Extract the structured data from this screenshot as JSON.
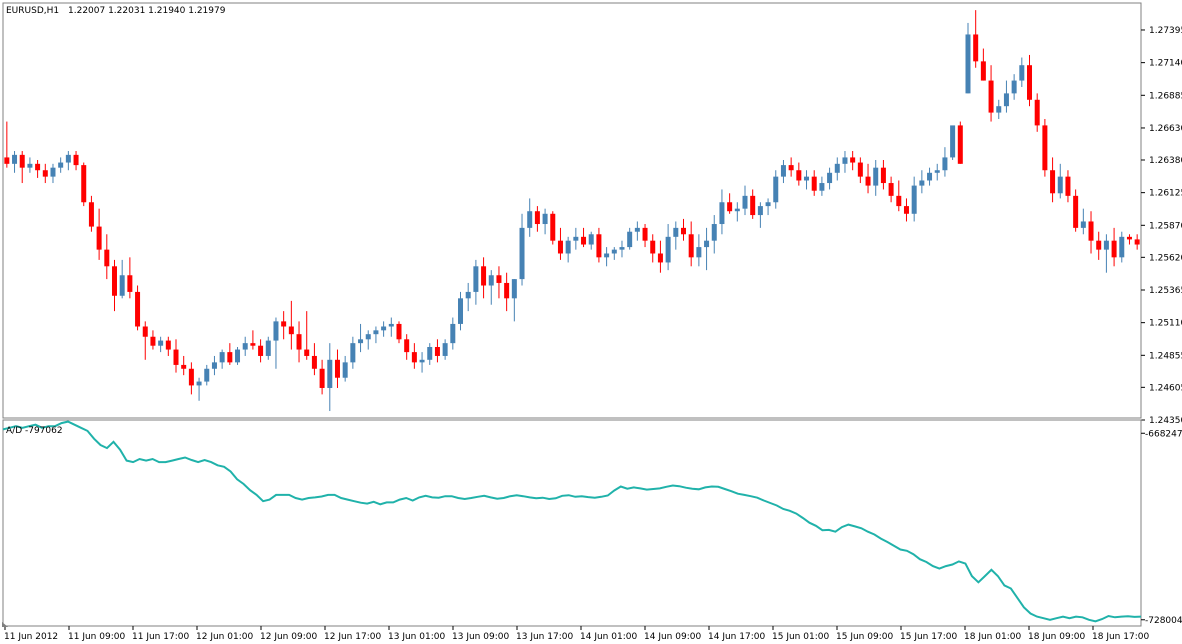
{
  "symbol_header": "EURUSD,H1",
  "ohlc_header": "1.22007 1.22031 1.21940 1.21979",
  "indicator_header": "A/D -797062",
  "colors": {
    "bull": "#4682b4",
    "bear": "#ff0000",
    "ad_line": "#20b2aa",
    "frame": "#808080",
    "background": "#ffffff",
    "text": "#000000"
  },
  "chart_data": [
    {
      "type": "candlestick",
      "title": "EURUSD,H1",
      "price_axis_ticks": [
        "1.27395",
        "1.27140",
        "1.26885",
        "1.26630",
        "1.26380",
        "1.26125",
        "1.25870",
        "1.25620",
        "1.25365",
        "1.25110",
        "1.24855",
        "1.24605",
        "1.24350"
      ],
      "ylim": [
        1.2435,
        1.2759
      ],
      "time_axis_labels": [
        "11 Jun 2012",
        "11 Jun 09:00",
        "11 Jun 17:00",
        "12 Jun 01:00",
        "12 Jun 09:00",
        "12 Jun 17:00",
        "13 Jun 01:00",
        "13 Jun 09:00",
        "13 Jun 17:00",
        "14 Jun 01:00",
        "14 Jun 09:00",
        "14 Jun 17:00",
        "15 Jun 01:00",
        "15 Jun 09:00",
        "15 Jun 17:00",
        "18 Jun 01:00",
        "18 Jun 09:00",
        "18 Jun 17:00"
      ],
      "candles": [
        [
          1.264,
          1.2668,
          1.2632,
          1.2635
        ],
        [
          1.2635,
          1.2645,
          1.2628,
          1.2642
        ],
        [
          1.2642,
          1.2645,
          1.262,
          1.2632
        ],
        [
          1.2632,
          1.264,
          1.2628,
          1.2635
        ],
        [
          1.2635,
          1.2638,
          1.2624,
          1.263
        ],
        [
          1.263,
          1.2635,
          1.262,
          1.2625
        ],
        [
          1.2625,
          1.2635,
          1.262,
          1.2632
        ],
        [
          1.2632,
          1.264,
          1.2628,
          1.2636
        ],
        [
          1.2636,
          1.2645,
          1.263,
          1.2642
        ],
        [
          1.2642,
          1.2645,
          1.263,
          1.2634
        ],
        [
          1.2634,
          1.2636,
          1.2602,
          1.2605
        ],
        [
          1.2605,
          1.261,
          1.2582,
          1.2586
        ],
        [
          1.2586,
          1.26,
          1.256,
          1.2568
        ],
        [
          1.2568,
          1.258,
          1.2545,
          1.2555
        ],
        [
          1.2555,
          1.256,
          1.252,
          1.2532
        ],
        [
          1.2532,
          1.256,
          1.253,
          1.2548
        ],
        [
          1.2548,
          1.2562,
          1.253,
          1.2535
        ],
        [
          1.2535,
          1.254,
          1.2505,
          1.2508
        ],
        [
          1.2508,
          1.2512,
          1.2482,
          1.25
        ],
        [
          1.25,
          1.2505,
          1.249,
          1.2493
        ],
        [
          1.2493,
          1.25,
          1.2488,
          1.2497
        ],
        [
          1.2497,
          1.25,
          1.2485,
          1.249
        ],
        [
          1.249,
          1.2498,
          1.2472,
          1.2478
        ],
        [
          1.2478,
          1.2485,
          1.247,
          1.2475
        ],
        [
          1.2475,
          1.248,
          1.2455,
          1.2462
        ],
        [
          1.2462,
          1.2468,
          1.245,
          1.2465
        ],
        [
          1.2465,
          1.2478,
          1.2462,
          1.2475
        ],
        [
          1.2475,
          1.2485,
          1.247,
          1.248
        ],
        [
          1.248,
          1.249,
          1.2475,
          1.2488
        ],
        [
          1.2488,
          1.2495,
          1.2478,
          1.248
        ],
        [
          1.248,
          1.2492,
          1.2478,
          1.249
        ],
        [
          1.249,
          1.25,
          1.2485,
          1.2495
        ],
        [
          1.2495,
          1.2505,
          1.249,
          1.2493
        ],
        [
          1.2493,
          1.2498,
          1.248,
          1.2485
        ],
        [
          1.2485,
          1.25,
          1.2482,
          1.2497
        ],
        [
          1.2497,
          1.2515,
          1.2475,
          1.2512
        ],
        [
          1.2512,
          1.252,
          1.2498,
          1.2508
        ],
        [
          1.2508,
          1.2528,
          1.249,
          1.2502
        ],
        [
          1.2502,
          1.2512,
          1.248,
          1.249
        ],
        [
          1.249,
          1.252,
          1.2482,
          1.2485
        ],
        [
          1.2485,
          1.2495,
          1.247,
          1.2475
        ],
        [
          1.2475,
          1.2482,
          1.2455,
          1.246
        ],
        [
          1.246,
          1.2495,
          1.2442,
          1.2482
        ],
        [
          1.2482,
          1.249,
          1.246,
          1.2468
        ],
        [
          1.2468,
          1.2485,
          1.2465,
          1.248
        ],
        [
          1.248,
          1.25,
          1.2475,
          1.2495
        ],
        [
          1.2495,
          1.251,
          1.2488,
          1.2498
        ],
        [
          1.2498,
          1.2505,
          1.249,
          1.2502
        ],
        [
          1.2502,
          1.2508,
          1.2495,
          1.2505
        ],
        [
          1.2505,
          1.2512,
          1.25,
          1.2508
        ],
        [
          1.2508,
          1.2515,
          1.25,
          1.251
        ],
        [
          1.251,
          1.2512,
          1.2495,
          1.2498
        ],
        [
          1.2498,
          1.2502,
          1.2482,
          1.2488
        ],
        [
          1.2488,
          1.2495,
          1.2475,
          1.248
        ],
        [
          1.248,
          1.2488,
          1.2472,
          1.2482
        ],
        [
          1.2482,
          1.2495,
          1.2478,
          1.2492
        ],
        [
          1.2492,
          1.2498,
          1.248,
          1.2485
        ],
        [
          1.2485,
          1.2498,
          1.2482,
          1.2495
        ],
        [
          1.2495,
          1.2515,
          1.249,
          1.251
        ],
        [
          1.251,
          1.2535,
          1.2505,
          1.253
        ],
        [
          1.253,
          1.2542,
          1.252,
          1.2535
        ],
        [
          1.2535,
          1.256,
          1.2525,
          1.2555
        ],
        [
          1.2555,
          1.2562,
          1.253,
          1.254
        ],
        [
          1.254,
          1.2552,
          1.2525,
          1.2548
        ],
        [
          1.2548,
          1.2555,
          1.253,
          1.2542
        ],
        [
          1.2542,
          1.255,
          1.252,
          1.253
        ],
        [
          1.253,
          1.2545,
          1.2512,
          1.2545
        ],
        [
          1.2545,
          1.2596,
          1.254,
          1.2585
        ],
        [
          1.2585,
          1.2608,
          1.2578,
          1.2598
        ],
        [
          1.2598,
          1.2602,
          1.2582,
          1.2588
        ],
        [
          1.2588,
          1.26,
          1.258,
          1.2596
        ],
        [
          1.2596,
          1.2598,
          1.2572,
          1.2575
        ],
        [
          1.2575,
          1.2585,
          1.256,
          1.2565
        ],
        [
          1.2565,
          1.2578,
          1.2558,
          1.2575
        ],
        [
          1.2575,
          1.2585,
          1.2568,
          1.2578
        ],
        [
          1.2578,
          1.2585,
          1.257,
          1.2572
        ],
        [
          1.2572,
          1.2582,
          1.2568,
          1.258
        ],
        [
          1.258,
          1.2585,
          1.2558,
          1.2562
        ],
        [
          1.2562,
          1.257,
          1.2555,
          1.2565
        ],
        [
          1.2565,
          1.257,
          1.256,
          1.2568
        ],
        [
          1.2568,
          1.2575,
          1.2562,
          1.257
        ],
        [
          1.257,
          1.2585,
          1.2568,
          1.2582
        ],
        [
          1.2582,
          1.259,
          1.2575,
          1.2585
        ],
        [
          1.2585,
          1.2588,
          1.257,
          1.2575
        ],
        [
          1.2575,
          1.258,
          1.2558,
          1.2565
        ],
        [
          1.2565,
          1.2575,
          1.255,
          1.2558
        ],
        [
          1.2558,
          1.2588,
          1.2552,
          1.2578
        ],
        [
          1.2578,
          1.259,
          1.2568,
          1.2585
        ],
        [
          1.2585,
          1.2592,
          1.2575,
          1.258
        ],
        [
          1.258,
          1.259,
          1.2555,
          1.2562
        ],
        [
          1.2562,
          1.258,
          1.2555,
          1.257
        ],
        [
          1.257,
          1.2585,
          1.2552,
          1.2575
        ],
        [
          1.2575,
          1.2595,
          1.2565,
          1.2588
        ],
        [
          1.2588,
          1.2615,
          1.258,
          1.2605
        ],
        [
          1.2605,
          1.2612,
          1.2596,
          1.2598
        ],
        [
          1.2598,
          1.2605,
          1.259,
          1.26
        ],
        [
          1.26,
          1.2618,
          1.2595,
          1.261
        ],
        [
          1.261,
          1.2615,
          1.2592,
          1.2595
        ],
        [
          1.2595,
          1.2605,
          1.2585,
          1.2602
        ],
        [
          1.2602,
          1.2608,
          1.2595,
          1.2605
        ],
        [
          1.2605,
          1.263,
          1.26,
          1.2625
        ],
        [
          1.2625,
          1.2638,
          1.262,
          1.2634
        ],
        [
          1.2634,
          1.264,
          1.2625,
          1.263
        ],
        [
          1.263,
          1.2636,
          1.2618,
          1.2622
        ],
        [
          1.2622,
          1.263,
          1.2615,
          1.2625
        ],
        [
          1.2625,
          1.263,
          1.261,
          1.2614
        ],
        [
          1.2614,
          1.2625,
          1.261,
          1.262
        ],
        [
          1.262,
          1.2632,
          1.2615,
          1.2628
        ],
        [
          1.2628,
          1.264,
          1.2622,
          1.2635
        ],
        [
          1.2635,
          1.2645,
          1.2628,
          1.264
        ],
        [
          1.264,
          1.2645,
          1.263,
          1.2636
        ],
        [
          1.2636,
          1.264,
          1.262,
          1.2625
        ],
        [
          1.2625,
          1.2635,
          1.2612,
          1.2618
        ],
        [
          1.2618,
          1.2638,
          1.261,
          1.2632
        ],
        [
          1.2632,
          1.2638,
          1.2615,
          1.262
        ],
        [
          1.262,
          1.2625,
          1.2605,
          1.261
        ],
        [
          1.261,
          1.2622,
          1.2598,
          1.2602
        ],
        [
          1.2602,
          1.2608,
          1.259,
          1.2596
        ],
        [
          1.2596,
          1.2625,
          1.259,
          1.2618
        ],
        [
          1.2618,
          1.263,
          1.2612,
          1.2622
        ],
        [
          1.2622,
          1.2632,
          1.2618,
          1.2628
        ],
        [
          1.2628,
          1.2635,
          1.2622,
          1.263
        ],
        [
          1.263,
          1.2648,
          1.2625,
          1.264
        ],
        [
          1.264,
          1.2662,
          1.2638,
          1.2665
        ],
        [
          1.2665,
          1.2668,
          1.2635,
          1.2635
        ],
        [
          1.269,
          1.2745,
          1.269,
          1.2736
        ],
        [
          1.2736,
          1.2755,
          1.271,
          1.2715
        ],
        [
          1.2715,
          1.2725,
          1.27,
          1.27
        ],
        [
          1.27,
          1.2712,
          1.2668,
          1.2675
        ],
        [
          1.2675,
          1.2685,
          1.267,
          1.268
        ],
        [
          1.268,
          1.27,
          1.2675,
          1.269
        ],
        [
          1.269,
          1.2705,
          1.2685,
          1.27
        ],
        [
          1.27,
          1.2718,
          1.2695,
          1.2712
        ],
        [
          1.2712,
          1.272,
          1.268,
          1.2685
        ],
        [
          1.2685,
          1.269,
          1.266,
          1.2665
        ],
        [
          1.2665,
          1.267,
          1.2625,
          1.263
        ],
        [
          1.263,
          1.264,
          1.2605,
          1.2612
        ],
        [
          1.2612,
          1.2635,
          1.2608,
          1.2625
        ],
        [
          1.2625,
          1.263,
          1.2605,
          1.261
        ],
        [
          1.261,
          1.2615,
          1.2582,
          1.2585
        ],
        [
          1.2585,
          1.26,
          1.258,
          1.259
        ],
        [
          1.259,
          1.2598,
          1.2565,
          1.2575
        ],
        [
          1.2575,
          1.2582,
          1.256,
          1.2568
        ],
        [
          1.2568,
          1.258,
          1.255,
          1.2575
        ],
        [
          1.2575,
          1.2585,
          1.2555,
          1.2562
        ],
        [
          1.2562,
          1.2582,
          1.2558,
          1.2578
        ],
        [
          1.2578,
          1.258,
          1.2572,
          1.2576
        ],
        [
          1.2576,
          1.258,
          1.2568,
          1.2572
        ]
      ]
    },
    {
      "type": "line",
      "title": "A/D -797062",
      "axis_ticks": [
        "-668247",
        "-728004"
      ],
      "ylim": [
        -730000,
        -664000
      ],
      "values": [
        -667000,
        -666500,
        -666000,
        -666500,
        -666000,
        -665500,
        -666500,
        -666000,
        -666000,
        -665000,
        -664500,
        -665500,
        -666500,
        -667500,
        -670000,
        -672000,
        -673000,
        -671000,
        -673500,
        -677000,
        -677500,
        -676500,
        -677000,
        -676500,
        -677500,
        -677500,
        -677000,
        -676500,
        -676000,
        -676800,
        -677500,
        -676800,
        -677500,
        -678500,
        -679000,
        -680500,
        -683000,
        -684500,
        -686500,
        -688000,
        -690000,
        -689500,
        -688000,
        -688000,
        -688000,
        -689000,
        -689500,
        -689000,
        -688800,
        -688500,
        -688000,
        -688000,
        -689000,
        -689500,
        -690000,
        -690500,
        -690800,
        -690200,
        -691000,
        -690400,
        -690400,
        -689500,
        -689000,
        -689800,
        -688800,
        -688300,
        -688800,
        -688900,
        -688400,
        -688400,
        -689000,
        -689300,
        -689000,
        -688600,
        -688300,
        -688800,
        -689200,
        -689000,
        -688400,
        -688100,
        -688400,
        -688800,
        -689100,
        -688900,
        -689300,
        -689100,
        -688300,
        -688100,
        -688600,
        -688400,
        -688700,
        -688900,
        -688600,
        -688200,
        -686600,
        -685300,
        -686000,
        -685600,
        -685900,
        -686300,
        -686100,
        -685900,
        -685400,
        -685000,
        -685200,
        -685700,
        -686000,
        -686200,
        -685600,
        -685300,
        -685400,
        -686100,
        -686800,
        -687600,
        -688000,
        -688400,
        -688900,
        -689800,
        -690600,
        -691400,
        -692500,
        -693100,
        -694000,
        -695400,
        -696900,
        -697900,
        -699300,
        -699200,
        -699800,
        -698300,
        -697500,
        -698100,
        -698700,
        -699800,
        -700700,
        -702000,
        -703100,
        -704300,
        -705500,
        -705900,
        -707000,
        -708600,
        -709500,
        -710800,
        -711600,
        -710800,
        -710300,
        -709300,
        -710000,
        -714000,
        -716000,
        -714000,
        -712000,
        -714000,
        -717000,
        -718000,
        -721000,
        -724000,
        -726000,
        -727000,
        -727500,
        -728000,
        -727500,
        -727000,
        -727500,
        -727000,
        -727200,
        -728000,
        -728500,
        -727800,
        -726800,
        -727200,
        -727000,
        -726900,
        -727100,
        -727000
      ]
    }
  ]
}
